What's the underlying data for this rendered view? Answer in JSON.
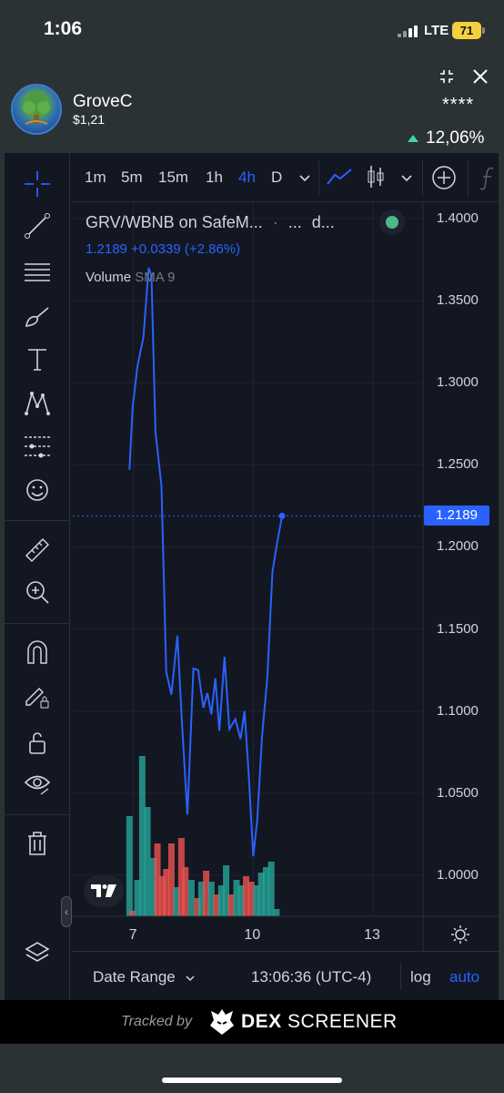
{
  "status_bar": {
    "time": "1:06",
    "network": "LTE",
    "battery": "71"
  },
  "token": {
    "name": "GroveC",
    "price": "$1,21",
    "masked": "****",
    "change": "12,06%"
  },
  "toolbar": {
    "timeframes": [
      "1m",
      "5m",
      "15m",
      "1h",
      "4h",
      "D"
    ],
    "active_timeframe": "4h"
  },
  "legend": {
    "title": "GRV/WBNB on SafeM...",
    "title_suffix": "d...",
    "price_line": "1.2189 +0.0339 (+2.86%)",
    "volume_label": "Volume",
    "volume_sma": "SMA 9"
  },
  "bottom_bar": {
    "date_range": "Date Range",
    "clock": "13:06:36 (UTC-4)",
    "log": "log",
    "auto": "auto"
  },
  "footer": {
    "tracked_by": "Tracked by",
    "brand_bold": "DEX",
    "brand_rest": "SCREENER"
  },
  "colors": {
    "line": "#2962ff",
    "vol_up": "#26a69a",
    "vol_down": "#ef5350",
    "background": "#131722"
  },
  "chart_data": {
    "type": "line",
    "y_ticks": [
      "1.4000",
      "1.3500",
      "1.3000",
      "1.2500",
      "1.2000",
      "1.1500",
      "1.1000",
      "1.0500",
      "1.0000"
    ],
    "x_ticks": [
      "7",
      "10",
      "13"
    ],
    "ylim": [
      0.975,
      1.41
    ],
    "xlim": [
      5.48,
      14.25
    ],
    "last_price_label": "1.2189",
    "series": [
      {
        "x": [
          6.9,
          6.98,
          7.1,
          7.25,
          7.38,
          7.45,
          7.55,
          7.7,
          7.82,
          7.95,
          8.1,
          8.22,
          8.35,
          8.5,
          8.62,
          8.75,
          8.85,
          8.95,
          9.05,
          9.15,
          9.28,
          9.4,
          9.55,
          9.68,
          9.78,
          9.88,
          10.0,
          10.1,
          10.22,
          10.35,
          10.48,
          10.6,
          10.72,
          10.83,
          10.95,
          11.08,
          11.2,
          11.3,
          11.4,
          11.55
        ],
        "y": [
          1.247,
          1.285,
          1.31,
          1.328,
          1.37,
          1.365,
          1.27,
          1.237,
          1.124,
          1.11,
          1.146,
          1.09,
          1.037,
          1.126,
          1.125,
          1.102,
          1.111,
          1.098,
          1.12,
          1.088,
          1.133,
          1.089,
          1.095,
          1.083,
          1.1,
          1.063,
          1.0115,
          1.034,
          1.085,
          1.12,
          1.185,
          1.203,
          1.2189,
          1.2189,
          1.2189,
          1.2189,
          1.2189,
          1.2189,
          1.2189,
          1.2189
        ]
      }
    ],
    "volume": [
      {
        "x": 6.9,
        "v": 0.55,
        "up": true
      },
      {
        "x": 6.98,
        "v": 0.03,
        "up": false
      },
      {
        "x": 7.1,
        "v": 0.2,
        "up": true
      },
      {
        "x": 7.22,
        "v": 0.88,
        "up": true
      },
      {
        "x": 7.35,
        "v": 0.6,
        "up": true
      },
      {
        "x": 7.5,
        "v": 0.32,
        "up": true
      },
      {
        "x": 7.6,
        "v": 0.4,
        "up": false
      },
      {
        "x": 7.72,
        "v": 0.22,
        "up": false
      },
      {
        "x": 7.82,
        "v": 0.26,
        "up": false
      },
      {
        "x": 7.95,
        "v": 0.4,
        "up": false
      },
      {
        "x": 8.08,
        "v": 0.16,
        "up": true
      },
      {
        "x": 8.2,
        "v": 0.43,
        "up": false
      },
      {
        "x": 8.3,
        "v": 0.27,
        "up": false
      },
      {
        "x": 8.45,
        "v": 0.2,
        "up": true
      },
      {
        "x": 8.6,
        "v": 0.1,
        "up": false
      },
      {
        "x": 8.7,
        "v": 0.19,
        "up": true
      },
      {
        "x": 8.82,
        "v": 0.25,
        "up": false
      },
      {
        "x": 8.95,
        "v": 0.19,
        "up": true
      },
      {
        "x": 9.08,
        "v": 0.12,
        "up": false
      },
      {
        "x": 9.2,
        "v": 0.17,
        "up": true
      },
      {
        "x": 9.32,
        "v": 0.28,
        "up": true
      },
      {
        "x": 9.45,
        "v": 0.12,
        "up": false
      },
      {
        "x": 9.58,
        "v": 0.2,
        "up": true
      },
      {
        "x": 9.7,
        "v": 0.17,
        "up": true
      },
      {
        "x": 9.82,
        "v": 0.22,
        "up": false
      },
      {
        "x": 9.95,
        "v": 0.19,
        "up": false
      },
      {
        "x": 10.08,
        "v": 0.17,
        "up": true
      },
      {
        "x": 10.2,
        "v": 0.24,
        "up": true
      },
      {
        "x": 10.32,
        "v": 0.27,
        "up": true
      },
      {
        "x": 10.45,
        "v": 0.3,
        "up": true
      },
      {
        "x": 10.58,
        "v": 0.04,
        "up": true
      }
    ]
  }
}
